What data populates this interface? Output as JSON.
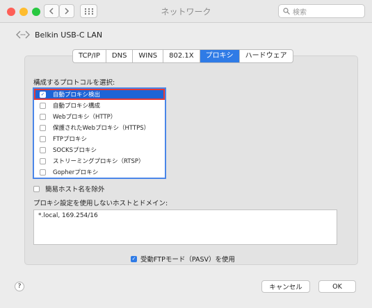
{
  "window": {
    "title": "ネットワーク"
  },
  "search": {
    "placeholder": "検索"
  },
  "device": {
    "name": "Belkin USB-C LAN"
  },
  "tabs": [
    {
      "label": "TCP/IP",
      "active": false
    },
    {
      "label": "DNS",
      "active": false
    },
    {
      "label": "WINS",
      "active": false
    },
    {
      "label": "802.1X",
      "active": false
    },
    {
      "label": "プロキシ",
      "active": true
    },
    {
      "label": "ハードウェア",
      "active": false
    }
  ],
  "protocols": {
    "section_label": "構成するプロトコルを選択:",
    "items": [
      {
        "label": "自動プロキシ検出",
        "checked": true,
        "selected": true
      },
      {
        "label": "自動プロキシ構成",
        "checked": false,
        "selected": false
      },
      {
        "label": "Webプロキシ（HTTP）",
        "checked": false,
        "selected": false
      },
      {
        "label": "保護されたWebプロキシ（HTTPS）",
        "checked": false,
        "selected": false
      },
      {
        "label": "FTPプロキシ",
        "checked": false,
        "selected": false
      },
      {
        "label": "SOCKSプロキシ",
        "checked": false,
        "selected": false
      },
      {
        "label": "ストリーミングプロキシ（RTSP）",
        "checked": false,
        "selected": false
      },
      {
        "label": "Gopherプロキシ",
        "checked": false,
        "selected": false
      }
    ]
  },
  "simple_hosts": {
    "label": "簡易ホスト名を除外",
    "checked": false
  },
  "bypass": {
    "label": "プロキシ設定を使用しないホストとドメイン:",
    "value": "*.local, 169.254/16"
  },
  "pasv": {
    "label": "受動FTPモード（PASV）を使用",
    "checked": true
  },
  "buttons": {
    "help": "?",
    "cancel": "キャンセル",
    "ok": "OK"
  },
  "colors": {
    "accent": "#2f7be6",
    "selection": "#1d64d6",
    "highlight_border": "#e53935"
  }
}
